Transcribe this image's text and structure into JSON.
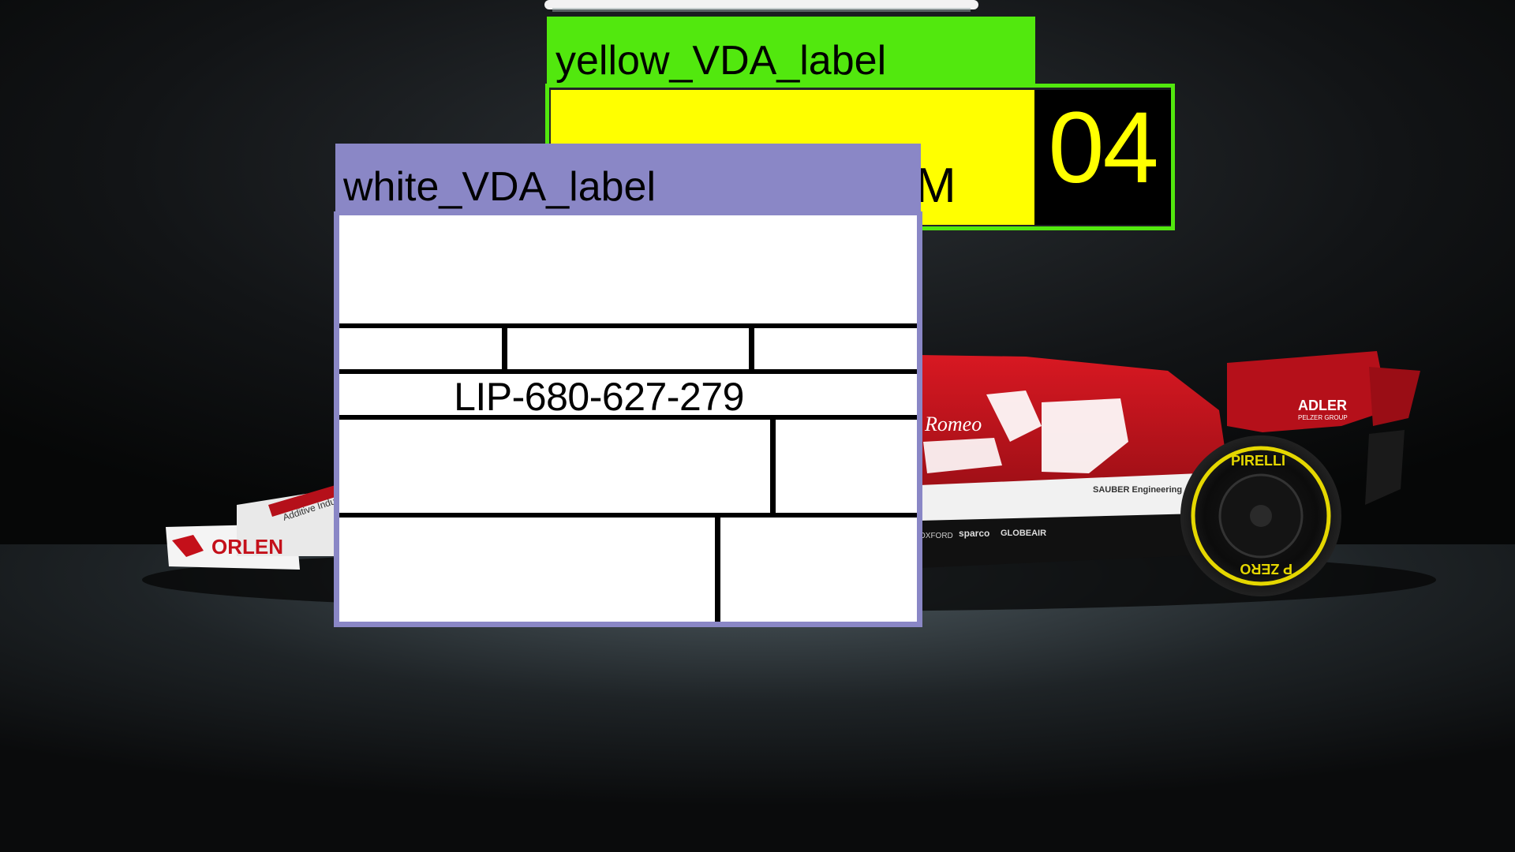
{
  "yellow_label": {
    "header": "yellow_VDA_label",
    "field_text": "M",
    "number": "04"
  },
  "white_label": {
    "header": "white_VDA_label",
    "id_text": "LIP-680-627-279"
  },
  "background": {
    "car_livery_text": [
      "ORLEN",
      "ADLER",
      "PELZER GROUP",
      "Romeo",
      "SAUBER Engineering",
      "sparco",
      "GLOBEAIR",
      "OXFORD",
      "PIRELLI",
      "P ZERO",
      "Additive Indust"
    ]
  },
  "colors": {
    "yellow_label_header": "#52e80e",
    "yellow_label_field": "#ffff00",
    "yellow_number_background": "#000000",
    "white_label_header": "#8a87c6",
    "car_red": "#b5101a"
  }
}
